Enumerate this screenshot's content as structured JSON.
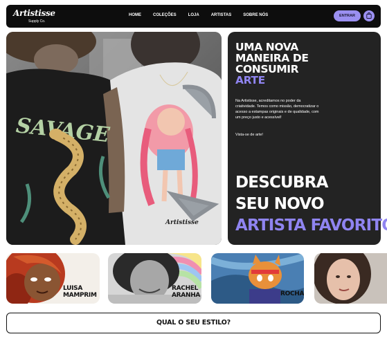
{
  "brand": {
    "name": "Artistisse",
    "tagline": "Supply Co."
  },
  "nav": {
    "links": [
      "HOME",
      "COLEÇÕES",
      "LOJA",
      "ARTISTAS",
      "SOBRE NÓS"
    ],
    "login_label": "ENTRAR",
    "cart_icon": "shopping-bag-icon"
  },
  "hero": {
    "headline_lines": [
      "UMA NOVA",
      "MANEIRA DE",
      "CONSUMIR"
    ],
    "headline_accent": "ARTE",
    "description": "Na Artistisse, acreditamos no poder da criatividade. Temos como missão, democratizar o acesso a estampas originais e de qualidade, com um preço justo e acessível!",
    "tagline": "Vista-se de arte!",
    "discover_lines": [
      "DESCUBRA",
      "SEU NOVO"
    ],
    "discover_accent": "ARTISTA FAVORITO!",
    "shirt_print_text": "SAVAGE"
  },
  "artists": [
    {
      "name_lines": [
        "LUISA",
        "MAMPRIM"
      ]
    },
    {
      "name_lines": [
        "RACHEL",
        "ARANHA"
      ]
    },
    {
      "name_lines": [
        "ROCHA"
      ]
    },
    {
      "name_lines": [
        ""
      ]
    }
  ],
  "cta": {
    "label": "QUAL O SEU ESTILO?"
  },
  "colors": {
    "accent": "#8f84f0",
    "dark": "#0d0d0d",
    "panel": "#232323"
  }
}
